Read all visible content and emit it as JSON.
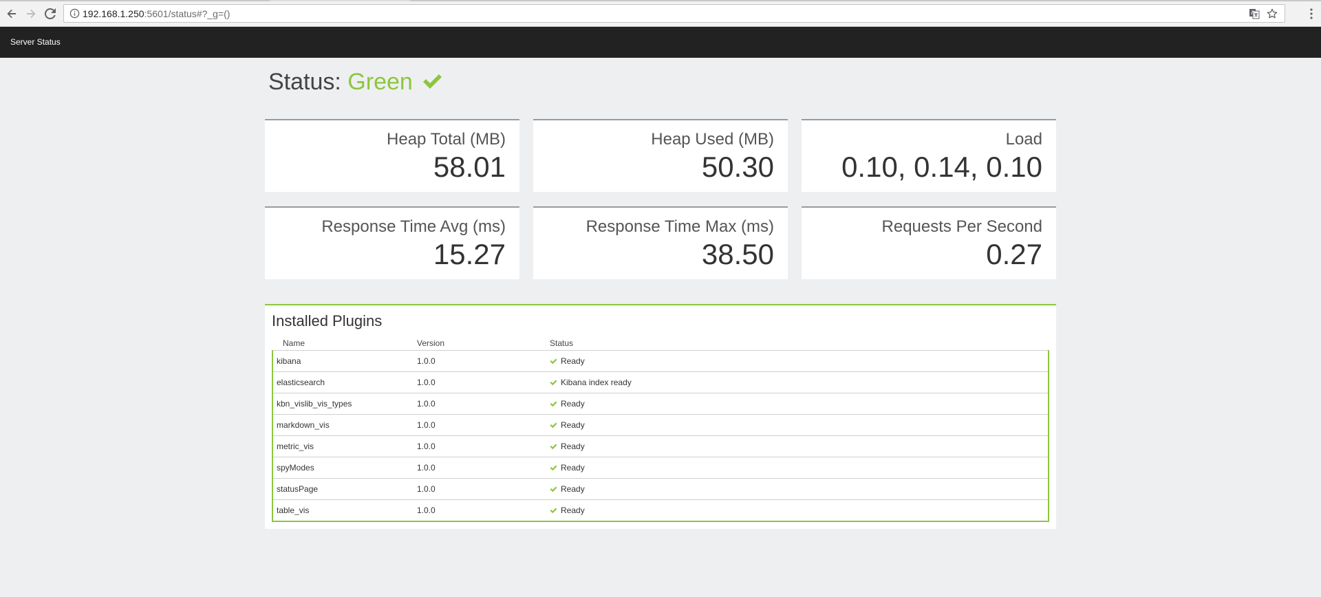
{
  "browser": {
    "url_host": "192.168.1.250",
    "url_rest": ":5601/status#?_g=()"
  },
  "header": {
    "title": "Server Status"
  },
  "status": {
    "label": "Status:",
    "state": "Green",
    "state_color": "#8cc63e"
  },
  "metrics": [
    {
      "title": "Heap Total (MB)",
      "value": "58.01"
    },
    {
      "title": "Heap Used (MB)",
      "value": "50.30"
    },
    {
      "title": "Load",
      "value": "0.10, 0.14, 0.10"
    },
    {
      "title": "Response Time Avg (ms)",
      "value": "15.27"
    },
    {
      "title": "Response Time Max (ms)",
      "value": "38.50"
    },
    {
      "title": "Requests Per Second",
      "value": "0.27"
    }
  ],
  "plugins": {
    "title": "Installed Plugins",
    "columns": {
      "name": "Name",
      "version": "Version",
      "status": "Status"
    },
    "rows": [
      {
        "name": "kibana",
        "version": "1.0.0",
        "status": "Ready"
      },
      {
        "name": "elasticsearch",
        "version": "1.0.0",
        "status": "Kibana index ready"
      },
      {
        "name": "kbn_vislib_vis_types",
        "version": "1.0.0",
        "status": "Ready"
      },
      {
        "name": "markdown_vis",
        "version": "1.0.0",
        "status": "Ready"
      },
      {
        "name": "metric_vis",
        "version": "1.0.0",
        "status": "Ready"
      },
      {
        "name": "spyModes",
        "version": "1.0.0",
        "status": "Ready"
      },
      {
        "name": "statusPage",
        "version": "1.0.0",
        "status": "Ready"
      },
      {
        "name": "table_vis",
        "version": "1.0.0",
        "status": "Ready"
      }
    ]
  },
  "icons": {
    "status_check": "check-icon",
    "row_check": "check-icon"
  }
}
